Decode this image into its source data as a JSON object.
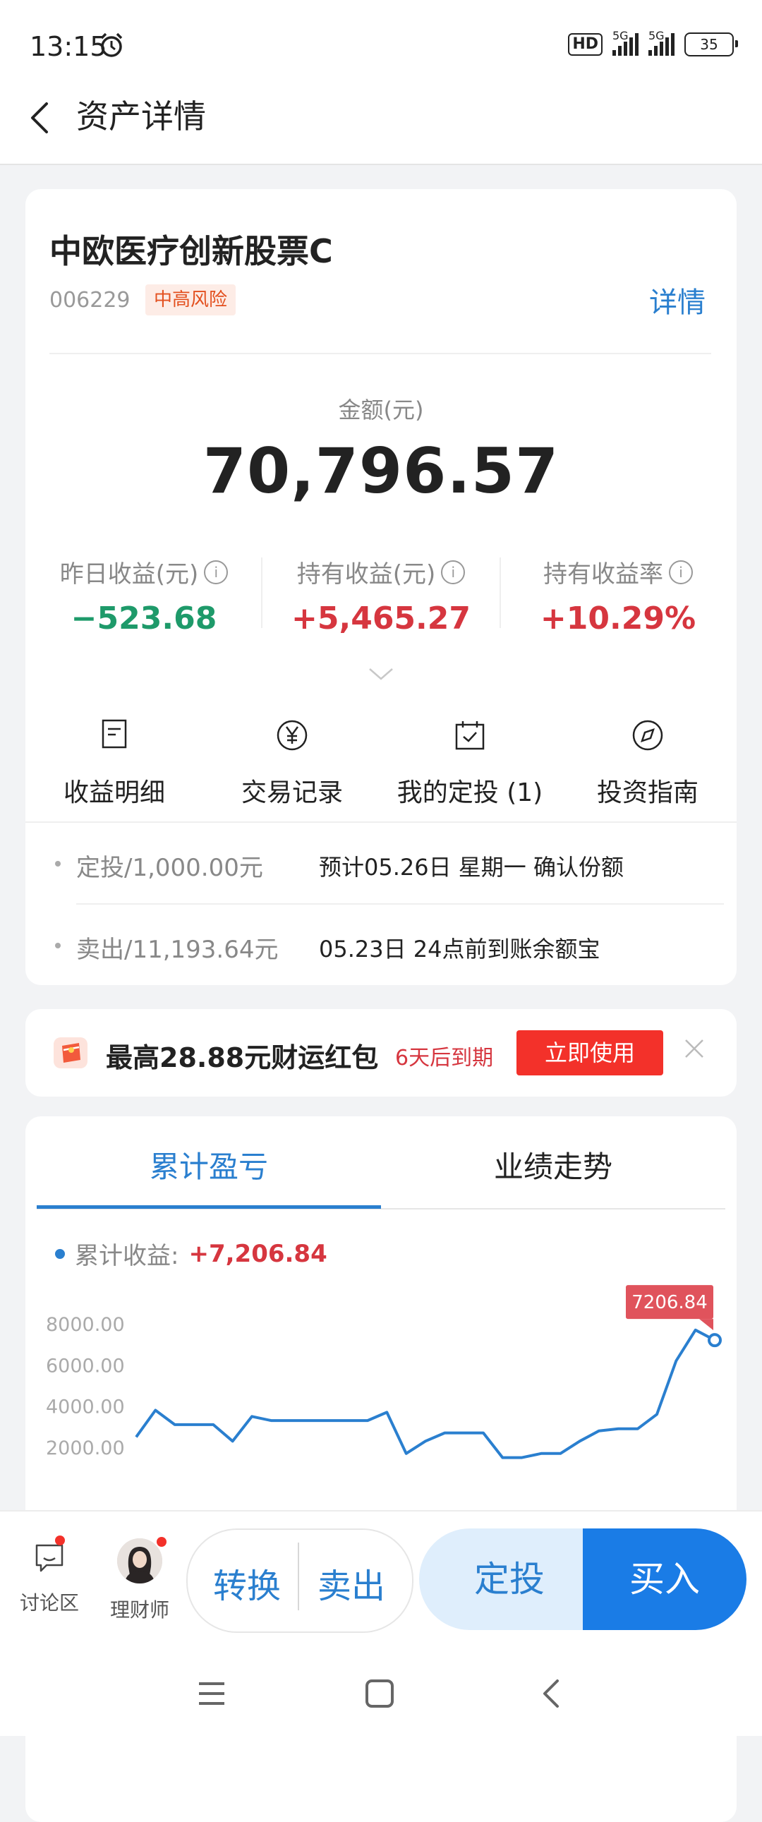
{
  "status_bar": {
    "time": "13:15",
    "hd": "HD",
    "net1": "5G",
    "net2": "5G",
    "battery": "35"
  },
  "header": {
    "title": "资产详情"
  },
  "fund": {
    "name": "中欧医疗创新股票C",
    "code": "006229",
    "risk": "中高风险",
    "detail_link": "详情"
  },
  "amount": {
    "label": "金额(元)",
    "value": "70,796.57"
  },
  "stats": [
    {
      "label": "昨日收益(元)",
      "value": "−523.68"
    },
    {
      "label": "持有收益(元)",
      "value": "+5,465.27"
    },
    {
      "label": "持有收益率",
      "value": "+10.29%"
    }
  ],
  "actions": [
    {
      "label": "收益明细",
      "icon": "document-icon"
    },
    {
      "label": "交易记录",
      "icon": "yen-circle-icon"
    },
    {
      "label": "我的定投 (1)",
      "icon": "calendar-check-icon"
    },
    {
      "label": "投资指南",
      "icon": "compass-icon"
    }
  ],
  "records": [
    {
      "left": "定投/1,000.00元",
      "right": "预计05.26日 星期一 确认份额"
    },
    {
      "left": "卖出/11,193.64元",
      "right": "05.23日 24点前到账余额宝"
    }
  ],
  "coupon": {
    "title": "最高28.88元财运红包",
    "expiry": "6天后到期",
    "button": "立即使用"
  },
  "tabs": [
    "累计盈亏",
    "业绩走势"
  ],
  "legend": {
    "label": "累计收益:",
    "value": "+7,206.84"
  },
  "chart_data": {
    "type": "line",
    "y_ticks": [
      "8000.00",
      "6000.00",
      "4000.00",
      "2000.00"
    ],
    "ylim": [
      0,
      8000
    ],
    "series": [
      {
        "values": [
          2500,
          3800,
          3100,
          3100,
          3100,
          2300,
          3500,
          3300,
          3300,
          3300,
          3300,
          3300,
          3300,
          3700,
          1700,
          2300,
          2700,
          2700,
          2700,
          1500,
          1500,
          1700,
          1700,
          2300,
          2800,
          2900,
          2900,
          3600,
          6200,
          7700,
          7206.84
        ]
      }
    ],
    "tooltip": "7206.84"
  },
  "bottom": {
    "discuss": "讨论区",
    "advisor": "理财师",
    "convert": "转换",
    "sell": "卖出",
    "auto_invest": "定投",
    "buy": "买入"
  },
  "colors": {
    "accent": "#2a7fcf",
    "gain": "#d6363f",
    "loss": "#1e9a6a",
    "buy": "#1a7ce6",
    "coupon": "#f3312a"
  }
}
